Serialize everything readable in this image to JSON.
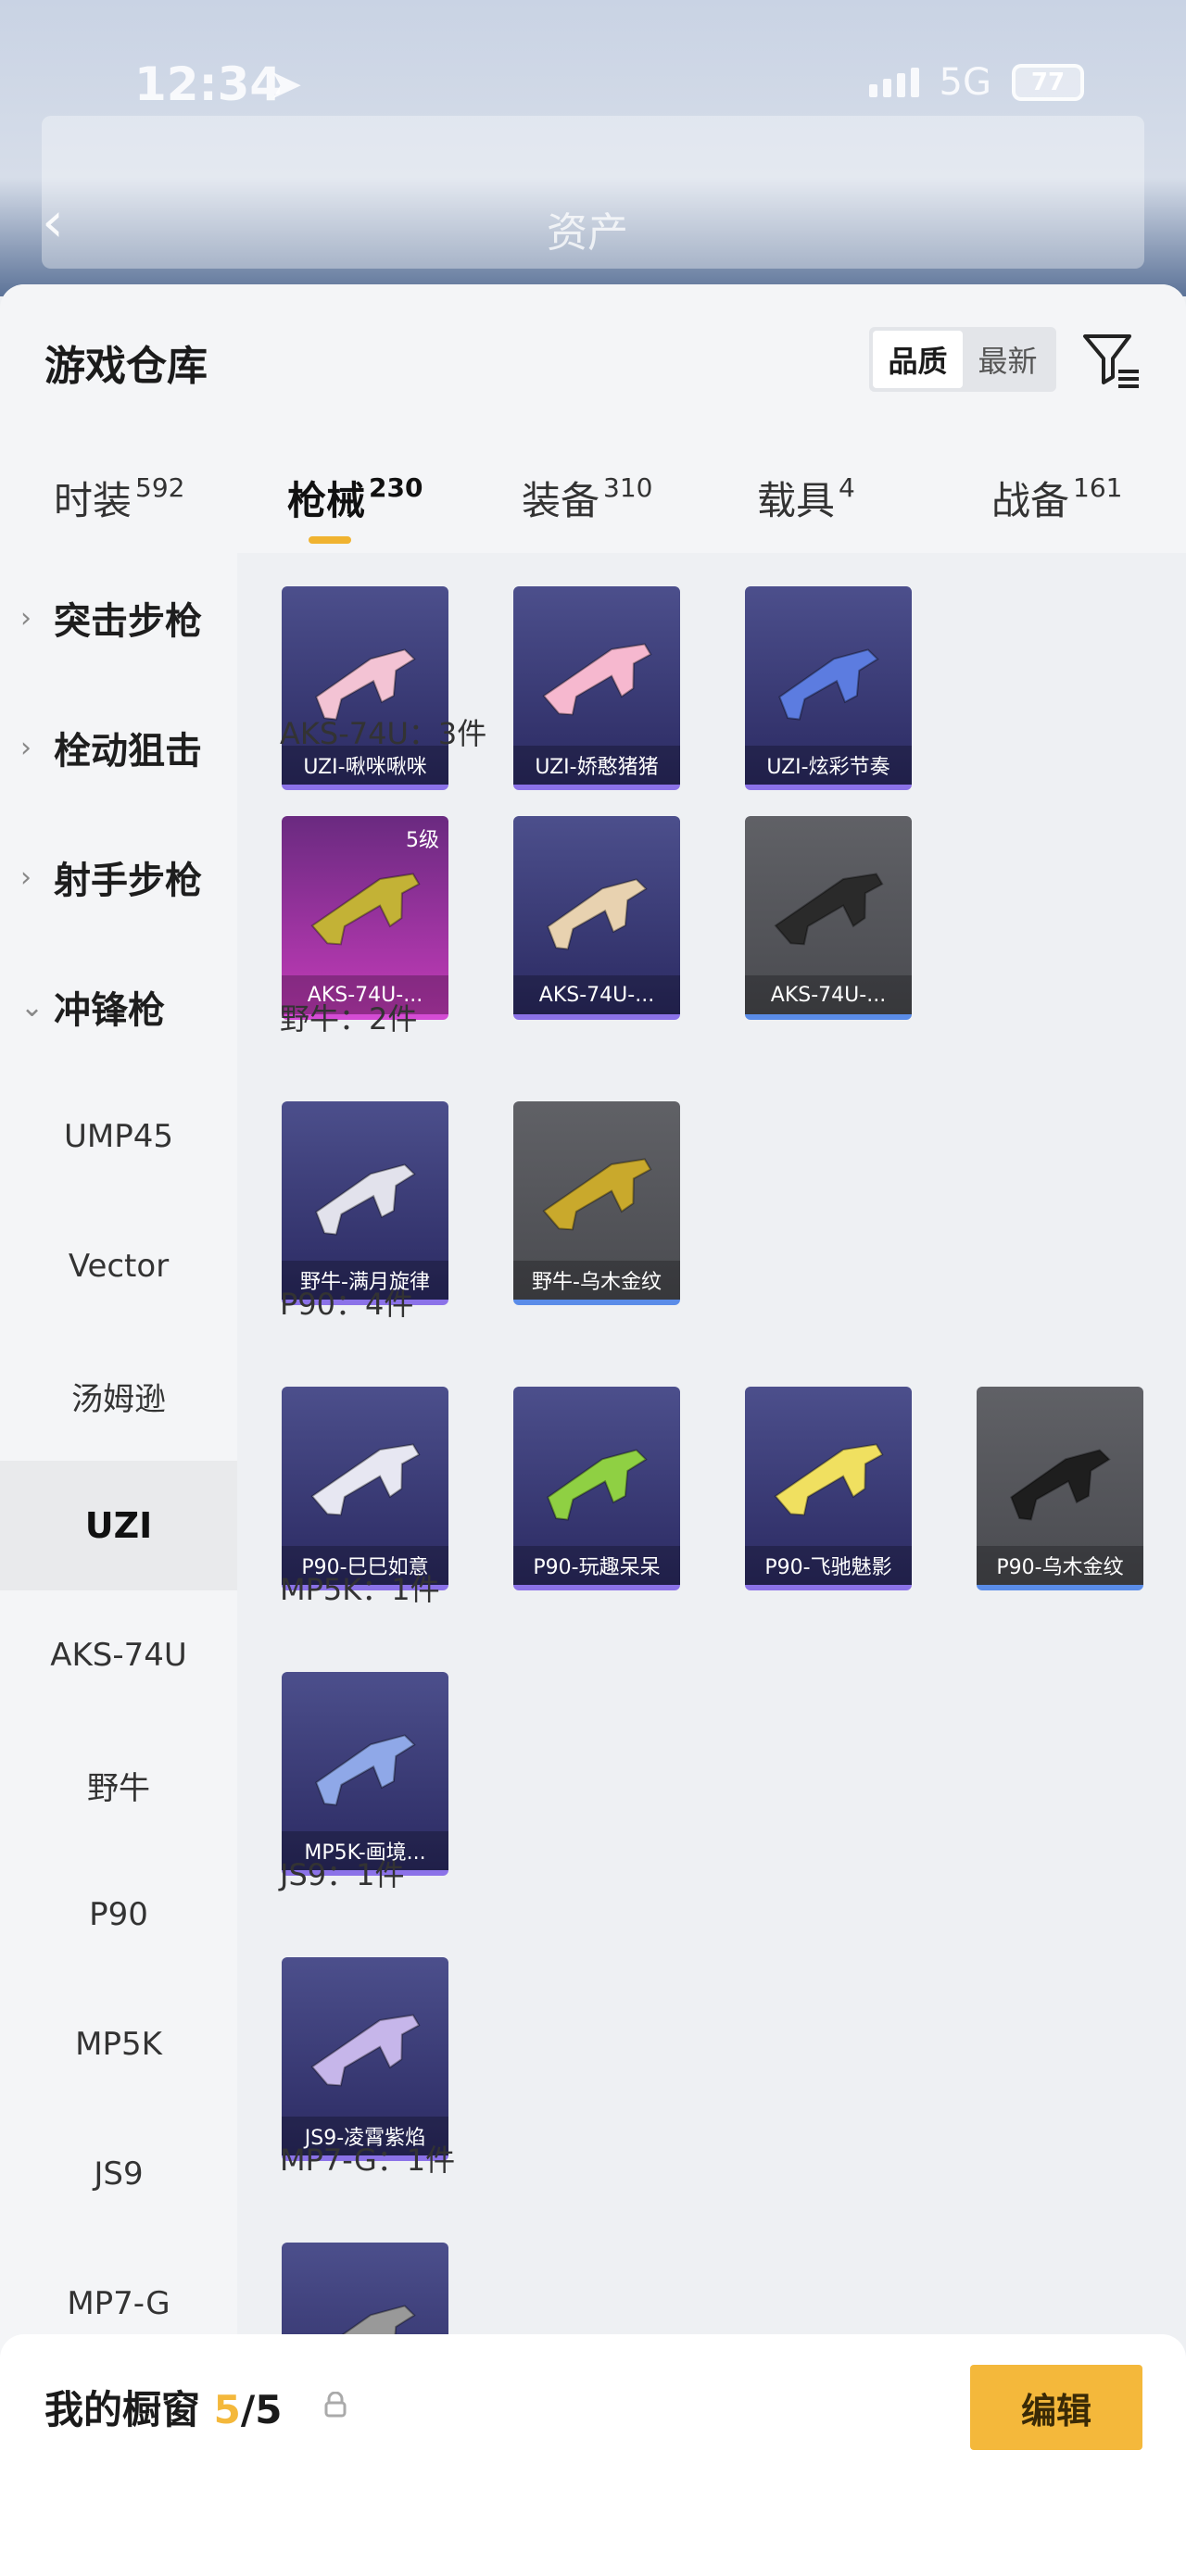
{
  "status": {
    "time": "12:34",
    "network": "5G",
    "battery": "77"
  },
  "header": {
    "title": "资产"
  },
  "sheet": {
    "title": "游戏仓库"
  },
  "sort": {
    "quality": "品质",
    "latest": "最新"
  },
  "tabs": [
    {
      "label": "时装",
      "count": "592"
    },
    {
      "label": "枪械",
      "count": "230"
    },
    {
      "label": "装备",
      "count": "310"
    },
    {
      "label": "载具",
      "count": "4"
    },
    {
      "label": "战备",
      "count": "161"
    }
  ],
  "sidebar": {
    "groups": [
      "突击步枪",
      "栓动狙击",
      "射手步枪",
      "冲锋枪"
    ],
    "items": [
      "UMP45",
      "Vector",
      "汤姆逊",
      "UZI",
      "AKS-74U",
      "野牛",
      "P90",
      "MP5K",
      "JS9",
      "MP7-G"
    ]
  },
  "groups": [
    {
      "title": "",
      "cards": [
        {
          "label": "UZI-啾咪啾咪",
          "style": "purple",
          "gun_color": "#f3c3d4"
        },
        {
          "label": "UZI-娇憨猪猪",
          "style": "purple",
          "gun_color": "#f6b8cf"
        },
        {
          "label": "UZI-炫彩节奏",
          "style": "purple",
          "gun_color": "#5c7ce0"
        }
      ]
    },
    {
      "title": "AKS-74U：3件",
      "cards": [
        {
          "label": "AKS-74U-...",
          "style": "pink",
          "gun_color": "#c3b236",
          "level": "5级"
        },
        {
          "label": "AKS-74U-...",
          "style": "purple",
          "gun_color": "#e8d2b0"
        },
        {
          "label": "AKS-74U-...",
          "style": "gray",
          "gun_color": "#2a2a2a"
        }
      ]
    },
    {
      "title": "野牛：2件",
      "cards": [
        {
          "label": "野牛-满月旋律",
          "style": "purple",
          "gun_color": "#e2e2ec"
        },
        {
          "label": "野牛-乌木金纹",
          "style": "gray",
          "gun_color": "#c9a92c"
        }
      ]
    },
    {
      "title": "P90：4件",
      "cards": [
        {
          "label": "P90-巳巳如意",
          "style": "purple",
          "gun_color": "#e7e7f2"
        },
        {
          "label": "P90-玩趣呆呆",
          "style": "purple",
          "gun_color": "#8fd043"
        },
        {
          "label": "P90-飞驰魅影",
          "style": "purple",
          "gun_color": "#f0e060"
        },
        {
          "label": "P90-乌木金纹",
          "style": "gray",
          "gun_color": "#1e1e1e"
        }
      ]
    },
    {
      "title": "MP5K：1件",
      "cards": [
        {
          "label": "MP5K-画境...",
          "style": "purple",
          "gun_color": "#8fa8e8"
        }
      ]
    },
    {
      "title": "JS9：1件",
      "cards": [
        {
          "label": "JS9-凌霄紫焰",
          "style": "purple",
          "gun_color": "#c6b6ea"
        }
      ]
    },
    {
      "title": "MP7-G：1件",
      "cards": [
        {
          "label": "",
          "style": "purple",
          "gun_color": "#999"
        }
      ]
    }
  ],
  "bottom": {
    "title": "我的橱窗",
    "count": "5",
    "total": "/5",
    "edit": "编辑"
  },
  "icons": {
    "back": "back-icon",
    "filter": "filter-icon",
    "share": "share-icon",
    "lock": "lock-icon",
    "chevron": "chevron-icon"
  },
  "colors": {
    "accent": "#f4b83b"
  }
}
